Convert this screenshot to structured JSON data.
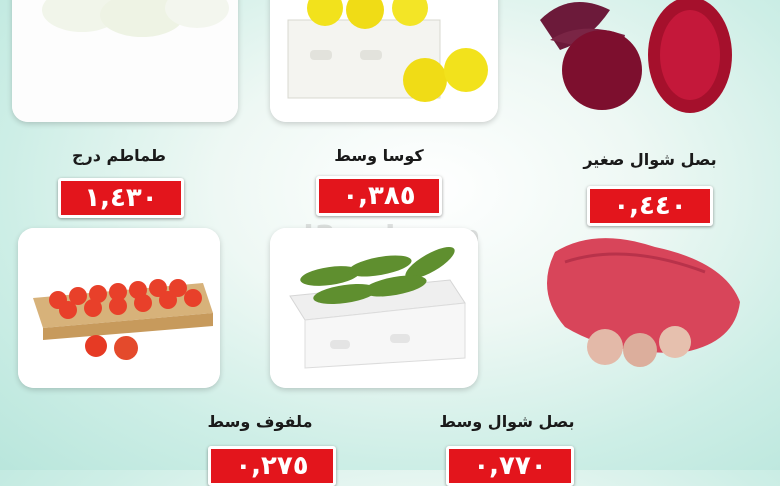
{
  "watermark": "el3rod.com",
  "products": [
    {
      "name": "طماطم درج",
      "price": "١,٤٣٠"
    },
    {
      "name": "كوسا وسط",
      "price": "٠,٣٨٥"
    },
    {
      "name": "بصل شوال صغير",
      "price": "٠,٤٤٠"
    },
    {
      "name": "ملفوف وسط",
      "price": "٠,٢٧٥"
    },
    {
      "name": "بصل شوال وسط",
      "price": "٠,٧٧٠"
    }
  ],
  "image_icons": [
    "cabbage-image",
    "lemons-box-image",
    "beetroot-image",
    "tomatoes-box-image",
    "cucumbers-box-image",
    "onion-sack-image"
  ]
}
